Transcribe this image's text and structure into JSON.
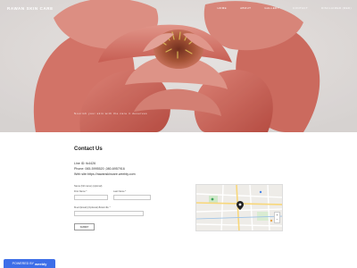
{
  "site": {
    "name": "RAWAN SKIN CARE",
    "nav": [
      "HOME",
      "ABOUT",
      "GALLERY",
      "CONTACT",
      "DISCLAIMER (RED)"
    ]
  },
  "hero": {
    "caption": "Nourish your skin with the care it deserves"
  },
  "contact": {
    "heading": "Contact Us",
    "line_id": "Line ID: tk4426",
    "phone": "Phone: 065-5995520 ,080-6957916",
    "web": "Web site:https://rawanskincare.weebly.com"
  },
  "form": {
    "name_label": "Name (full name) (optional)",
    "first_name": "First Name *",
    "last_name": "Last Name *",
    "email_label": "อีเมล์ (Email) (Optional) ติดต่อกลับ *",
    "submit": "SUBMIT"
  },
  "footer": {
    "powered_by": "POWERED BY",
    "brand": "weebly"
  },
  "colors": {
    "accent": "#3d6ee8",
    "peony": "#e8837a"
  },
  "icons": {
    "map_pin": "map-pin-icon"
  }
}
